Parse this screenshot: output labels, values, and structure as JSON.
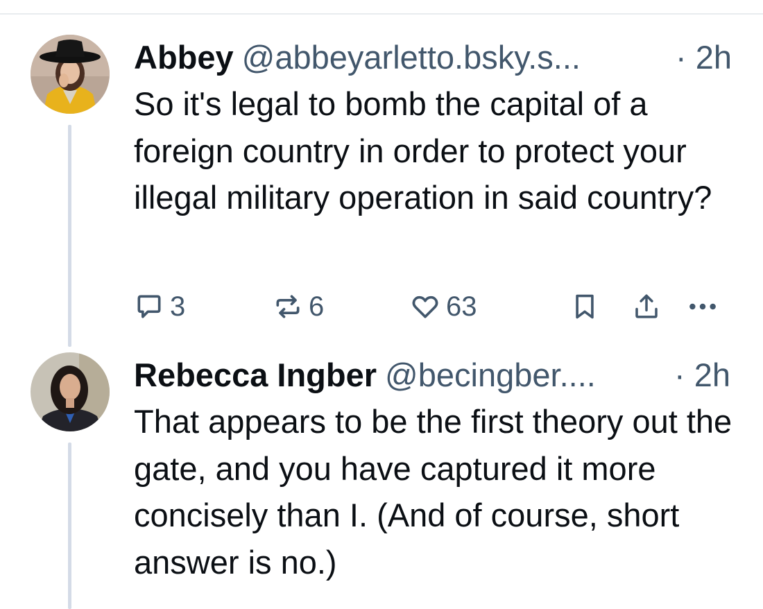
{
  "posts": [
    {
      "display_name": "Abbey",
      "handle": "@abbeyarletto.bsky.s...",
      "timestamp": "· 2h",
      "body": "So it's legal to bomb the capital of a foreign country in order to protect your illegal military operation in said country?",
      "reply_count": "3",
      "repost_count": "6",
      "like_count": "63",
      "avatar_icon": "avatar-woman-black-hat-yellow-jacket"
    },
    {
      "display_name": "Rebecca Ingber",
      "handle": "@becingber....",
      "timestamp": "· 2h",
      "body": "That appears to be the first theory out the gate, and you have captured it more concisely than I. (And of course, short answer is no.)",
      "avatar_icon": "avatar-woman-dark-hair"
    }
  ],
  "icons": {
    "reply": "speech-bubble-icon",
    "repost": "repost-arrows-icon",
    "like": "heart-icon",
    "bookmark": "bookmark-icon",
    "share": "share-icon",
    "more": "ellipsis-icon"
  },
  "colors": {
    "text": "#0b0f14",
    "muted": "#42576c",
    "thread_line": "#d4dbe7"
  }
}
